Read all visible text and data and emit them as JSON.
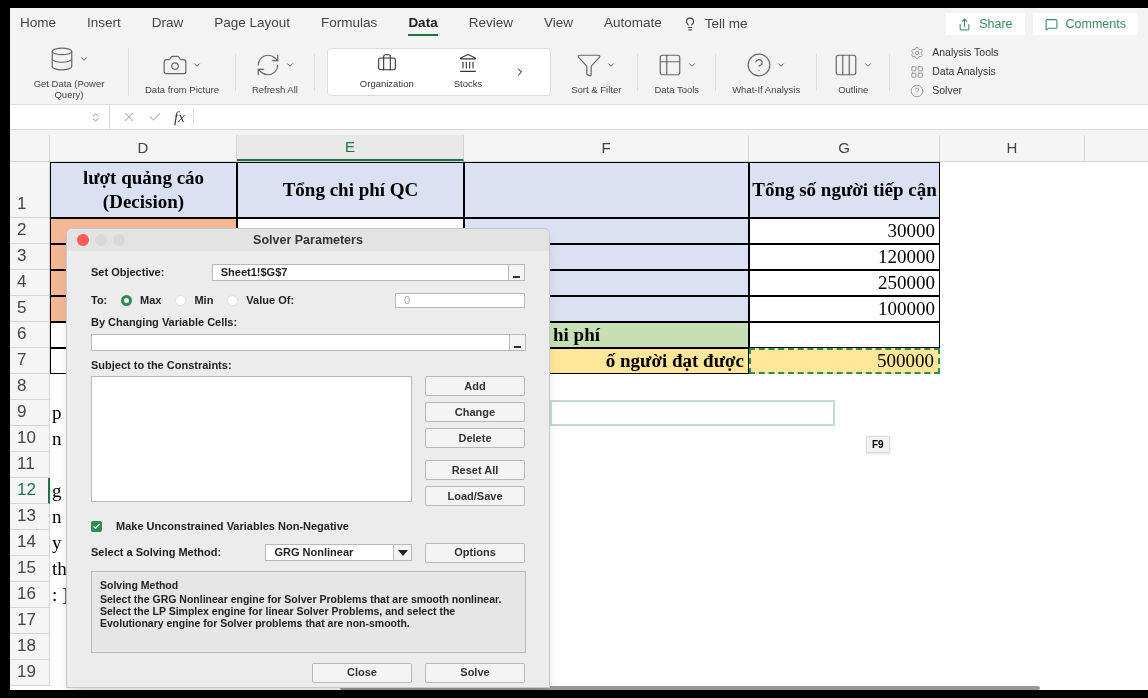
{
  "menu_tabs": [
    {
      "label": "Home",
      "selected": false
    },
    {
      "label": "Insert",
      "selected": false
    },
    {
      "label": "Draw",
      "selected": false
    },
    {
      "label": "Page Layout",
      "selected": false
    },
    {
      "label": "Formulas",
      "selected": false
    },
    {
      "label": "Data",
      "selected": true
    },
    {
      "label": "Review",
      "selected": false
    },
    {
      "label": "View",
      "selected": false
    },
    {
      "label": "Automate",
      "selected": false
    }
  ],
  "tell_me": "Tell me",
  "share_button": "Share",
  "comments_button": "Comments",
  "ribbon": [
    {
      "kind": "get_data",
      "label": "Get Data (Power Query)"
    },
    {
      "kind": "picture",
      "label": "Data from Picture"
    },
    {
      "kind": "refresh",
      "label": "Refresh All"
    },
    {
      "kind": "types",
      "items": [
        {
          "kind": "organization",
          "label": "Organization"
        },
        {
          "kind": "stocks",
          "label": "Stocks"
        }
      ]
    },
    {
      "kind": "sort",
      "label": "Sort & Filter"
    },
    {
      "kind": "tools",
      "label": "Data Tools"
    },
    {
      "kind": "whatif",
      "label": "What-If Analysis"
    },
    {
      "kind": "outline",
      "label": "Outline"
    },
    {
      "kind": "list",
      "items": [
        {
          "kind": "analysis_tools",
          "label": "Analysis Tools"
        },
        {
          "kind": "data_analysis",
          "label": "Data Analysis"
        },
        {
          "kind": "solver",
          "label": "Solver"
        }
      ]
    }
  ],
  "columns": [
    {
      "label": "D",
      "selected": false
    },
    {
      "label": "E",
      "selected": true
    },
    {
      "label": "F",
      "selected": false
    },
    {
      "label": "G",
      "selected": false
    },
    {
      "label": "H",
      "selected": false
    }
  ],
  "rows": [
    {
      "number": "1",
      "selected": false,
      "cells": [
        {
          "kind": "heading",
          "text": "lượt quảng cáo (Decision)"
        },
        {
          "kind": "heading",
          "text": "Tổng chi phí QC"
        },
        {
          "kind": "heading"
        },
        {
          "kind": "heading",
          "text": "Tổng số người tiếp cận"
        },
        {
          "kind": "blank"
        }
      ]
    },
    {
      "number": "2",
      "selected": false,
      "cells": [
        {
          "kind": "input"
        },
        {
          "kind": "value"
        },
        {
          "kind": "heading"
        },
        {
          "kind": "value",
          "text": "30000"
        },
        {
          "kind": "blank"
        }
      ]
    },
    {
      "number": "3",
      "selected": false,
      "cells": [
        {
          "kind": "input"
        },
        {
          "kind": "blank"
        },
        {
          "kind": "heading"
        },
        {
          "kind": "value",
          "text": "120000"
        },
        {
          "kind": "blank"
        }
      ]
    },
    {
      "number": "4",
      "selected": false,
      "cells": [
        {
          "kind": "input"
        },
        {
          "kind": "blank"
        },
        {
          "kind": "heading"
        },
        {
          "kind": "value",
          "text": "250000"
        },
        {
          "kind": "blank"
        }
      ]
    },
    {
      "number": "5",
      "selected": false,
      "cells": [
        {
          "kind": "input"
        },
        {
          "kind": "blank"
        },
        {
          "kind": "heading"
        },
        {
          "kind": "value",
          "text": "100000"
        },
        {
          "kind": "blank"
        }
      ]
    },
    {
      "number": "6",
      "selected": false,
      "cells": [
        {
          "kind": "value"
        },
        {
          "kind": "blank"
        },
        {
          "kind": "total",
          "text": "hi phí"
        },
        {
          "kind": "value"
        },
        {
          "kind": "blank"
        }
      ]
    },
    {
      "number": "7",
      "selected": false,
      "cells": [
        {
          "kind": "value"
        },
        {
          "kind": "blank"
        },
        {
          "kind": "result_label",
          "text": "ố người đạt được"
        },
        {
          "kind": "result",
          "text": "500000"
        },
        {
          "kind": "blank"
        }
      ]
    },
    {
      "number": "8",
      "selected": false,
      "cells": [
        {
          "kind": "blank"
        },
        {
          "kind": "blank"
        },
        {
          "kind": "blank"
        },
        {
          "kind": "blank"
        },
        {
          "kind": "blank"
        }
      ]
    },
    {
      "number": "9",
      "selected": false,
      "cells": [
        {
          "kind": "overflow",
          "text": "p"
        },
        {
          "kind": "blank"
        },
        {
          "kind": "outline"
        },
        {
          "kind": "blank"
        },
        {
          "kind": "blank"
        }
      ]
    },
    {
      "number": "10",
      "selected": false,
      "cells": [
        {
          "kind": "overflow",
          "text": "n"
        },
        {
          "kind": "blank"
        },
        {
          "kind": "blank"
        },
        {
          "kind": "blank"
        },
        {
          "kind": "blank"
        }
      ]
    },
    {
      "number": "11",
      "selected": false,
      "cells": [
        {
          "kind": "blank"
        },
        {
          "kind": "blank"
        },
        {
          "kind": "blank"
        },
        {
          "kind": "blank"
        },
        {
          "kind": "blank"
        }
      ]
    },
    {
      "number": "12",
      "selected": true,
      "cells": [
        {
          "kind": "overflow",
          "text": "g"
        },
        {
          "kind": "blank"
        },
        {
          "kind": "blank"
        },
        {
          "kind": "blank"
        },
        {
          "kind": "blank"
        }
      ]
    },
    {
      "number": "13",
      "selected": false,
      "cells": [
        {
          "kind": "overflow",
          "text": "n"
        },
        {
          "kind": "blank"
        },
        {
          "kind": "blank"
        },
        {
          "kind": "blank"
        },
        {
          "kind": "blank"
        }
      ]
    },
    {
      "number": "14",
      "selected": false,
      "cells": [
        {
          "kind": "overflow",
          "text": "y"
        },
        {
          "kind": "blank"
        },
        {
          "kind": "blank"
        },
        {
          "kind": "blank"
        },
        {
          "kind": "blank"
        }
      ]
    },
    {
      "number": "15",
      "selected": false,
      "cells": [
        {
          "kind": "overflow",
          "text": "th"
        },
        {
          "kind": "blank"
        },
        {
          "kind": "blank"
        },
        {
          "kind": "blank"
        },
        {
          "kind": "blank"
        }
      ]
    },
    {
      "number": "16",
      "selected": false,
      "cells": [
        {
          "kind": "overflow",
          "text": ": ]"
        },
        {
          "kind": "blank"
        },
        {
          "kind": "blank"
        },
        {
          "kind": "blank"
        },
        {
          "kind": "blank"
        }
      ]
    },
    {
      "number": "17",
      "selected": false,
      "cells": [
        {
          "kind": "blank"
        },
        {
          "kind": "blank"
        },
        {
          "kind": "blank"
        },
        {
          "kind": "blank"
        },
        {
          "kind": "blank"
        }
      ]
    },
    {
      "number": "18",
      "selected": false,
      "cells": [
        {
          "kind": "blank"
        },
        {
          "kind": "blank"
        },
        {
          "kind": "blank"
        },
        {
          "kind": "blank"
        },
        {
          "kind": "blank"
        }
      ]
    },
    {
      "number": "19",
      "selected": false,
      "cells": [
        {
          "kind": "blank"
        },
        {
          "kind": "blank"
        },
        {
          "kind": "blank"
        },
        {
          "kind": "blank"
        },
        {
          "kind": "blank"
        }
      ]
    }
  ],
  "tooltip": "F9",
  "formula_bar": {
    "function_label": "fx"
  },
  "dialog": {
    "title": "Solver Parameters",
    "set_objective": {
      "label": "Set Objective:",
      "value": "Sheet1!$G$7"
    },
    "to": {
      "label": "To:",
      "options": [
        {
          "label": "Max",
          "selected": true
        },
        {
          "label": "Min",
          "selected": false
        },
        {
          "label": "Value Of:",
          "selected": false
        }
      ],
      "value_of": {
        "placeholder": "0"
      }
    },
    "changing_cells": {
      "label": "By Changing Variable Cells:"
    },
    "constraints": {
      "label": "Subject to the Constraints:"
    },
    "side_buttons": [
      "Add",
      "Change",
      "Delete",
      "Reset All",
      "Load/Save"
    ],
    "non_negative": {
      "label": "Make Unconstrained Variables Non-Negative",
      "checked": true
    },
    "method": {
      "label": "Select a Solving Method:",
      "value": "GRG Nonlinear"
    },
    "options_button": "Options",
    "info": {
      "title": "Solving Method",
      "text": "Select the GRG Nonlinear engine for Solver Problems that are smooth nonlinear. Select the LP Simplex engine for linear Solver Problems, and select the Evolutionary engine for Solver problems that are non-smooth."
    },
    "footer_buttons": [
      "Close",
      "Solve"
    ]
  }
}
